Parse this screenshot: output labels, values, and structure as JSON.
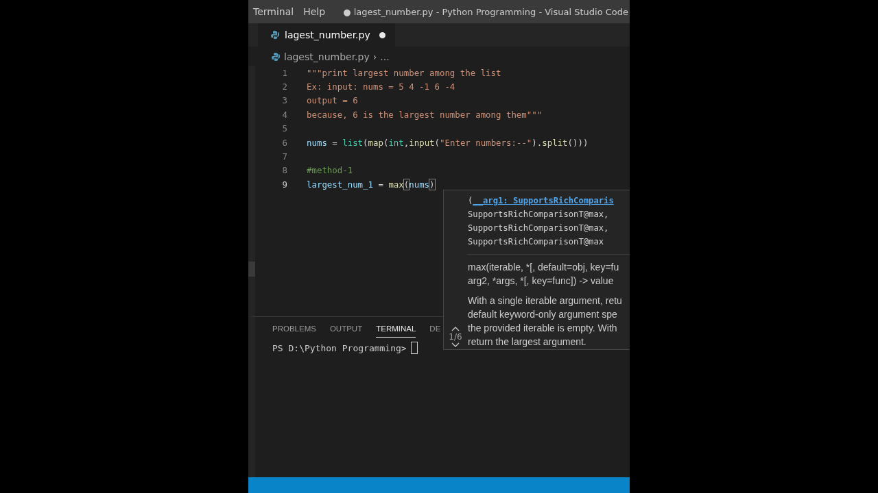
{
  "menu": [
    "Terminal",
    "Help"
  ],
  "window": {
    "title": "● lagest_number.py - Python Programming - Visual Studio Code"
  },
  "tabs": [
    {
      "label": "lagest_number.py",
      "selected": true,
      "dirty": true
    }
  ],
  "breadcrumb": {
    "file": "lagest_number.py",
    "separator": "›",
    "rest": "..."
  },
  "code_lines": [
    {
      "number": "1",
      "current": false,
      "tokens": [
        {
          "kind": "string",
          "text": "\"\"\"print largest number among the list"
        }
      ]
    },
    {
      "number": "2",
      "current": false,
      "tokens": [
        {
          "kind": "string",
          "text": "Ex: input: nums = 5 4 -1 6 -4"
        }
      ]
    },
    {
      "number": "3",
      "current": false,
      "tokens": [
        {
          "kind": "string",
          "text": "output = 6"
        }
      ]
    },
    {
      "number": "4",
      "current": false,
      "tokens": [
        {
          "kind": "string",
          "text": "because, 6 is the largest number among them\"\"\""
        }
      ]
    },
    {
      "number": "5",
      "current": false
    },
    {
      "number": "6",
      "current": false,
      "tokens": [
        {
          "kind": "variable",
          "text": "nums"
        },
        {
          "kind": "punct",
          "text": " = "
        },
        {
          "kind": "class",
          "text": "list"
        },
        {
          "kind": "punct",
          "text": "("
        },
        {
          "kind": "function",
          "text": "map"
        },
        {
          "kind": "punct",
          "text": "("
        },
        {
          "kind": "class",
          "text": "int"
        },
        {
          "kind": "punct",
          "text": ","
        },
        {
          "kind": "function",
          "text": "input"
        },
        {
          "kind": "punct",
          "text": "("
        },
        {
          "kind": "string",
          "text": "\"Enter numbers:--\""
        },
        {
          "kind": "punct",
          "text": ")."
        },
        {
          "kind": "function",
          "text": "split"
        },
        {
          "kind": "punct",
          "text": "()))"
        }
      ]
    },
    {
      "number": "7",
      "current": false
    },
    {
      "number": "8",
      "current": false,
      "tokens": [
        {
          "kind": "comment",
          "text": "#method-1"
        }
      ]
    },
    {
      "number": "9",
      "current": true,
      "tokens": [
        {
          "kind": "variable",
          "text": "largest_num_1"
        },
        {
          "kind": "punct",
          "text": " = "
        },
        {
          "kind": "function",
          "text": "max"
        },
        {
          "kind": "bracket",
          "text": "("
        },
        {
          "kind": "variable",
          "text": "nums"
        },
        {
          "kind": "bracket",
          "text": ")"
        }
      ]
    }
  ],
  "hover": {
    "counter": "1/6",
    "signature": [
      {
        "kind": "punct",
        "text": "("
      },
      {
        "kind": "param",
        "text": "__arg1: SupportsRichComparis"
      }
    ],
    "signature_lines": [
      "SupportsRichComparisonT@max,",
      "SupportsRichComparisonT@max,",
      "SupportsRichComparisonT@max"
    ],
    "doc_signature": [
      "max(iterable, *[, default=obj, key=fu",
      "arg2, *args, *[, key=func]) -> value"
    ],
    "doc": [
      "With a single iterable argument, retu",
      "default keyword-only argument spe",
      "the provided iterable is empty. With",
      "return the largest argument."
    ]
  },
  "panel": {
    "tabs": [
      {
        "label": "PROBLEMS",
        "selected": false
      },
      {
        "label": "OUTPUT",
        "selected": false
      },
      {
        "label": "TERMINAL",
        "selected": true
      },
      {
        "label": "DE",
        "selected": false
      }
    ],
    "terminal_prompt": "PS D:\\Python Programming>"
  }
}
